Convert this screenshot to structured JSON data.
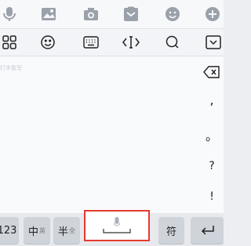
{
  "top_icons": [
    "microphone-icon",
    "image-icon",
    "camera-icon",
    "clipboard-icon",
    "smile-icon",
    "plus-icon"
  ],
  "toolbar_icons": [
    "grid-icon",
    "emoji-icon",
    "keyboard-icon",
    "cursor-icon",
    "search-icon",
    "collapse-icon"
  ],
  "hint_text": "打字盈写",
  "punctuation": {
    "comma": ",",
    "period": "。",
    "question": "?",
    "exclaim": "!"
  },
  "keys": {
    "num": "123",
    "cn_main": "中",
    "cn_sub": "英",
    "half_main": "半",
    "half_sub": "全",
    "symbol": "符",
    "enter": "⏎"
  },
  "colors": {
    "accent": "#e33a2f",
    "icon": "#9aa1ab"
  }
}
